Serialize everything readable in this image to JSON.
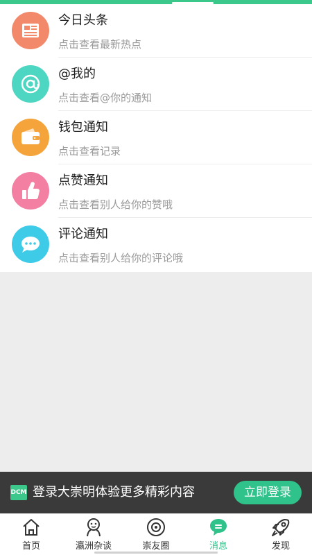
{
  "messages": [
    {
      "title": "今日头条",
      "subtitle": "点击查看最新热点",
      "icon": "newspaper-icon",
      "color": "#f2896b"
    },
    {
      "title": "@我的",
      "subtitle": "点击查看@你的通知",
      "icon": "at-icon",
      "color": "#4dd6c1"
    },
    {
      "title": "钱包通知",
      "subtitle": "点击查看记录",
      "icon": "wallet-icon",
      "color": "#f4a43a"
    },
    {
      "title": "点赞通知",
      "subtitle": "点击查看别人给你的赞哦",
      "icon": "thumbs-up-icon",
      "color": "#f37fa3"
    },
    {
      "title": "评论通知",
      "subtitle": "点击查看别人给你的评论哦",
      "icon": "comment-icon",
      "color": "#3dcbe8"
    }
  ],
  "login_banner": {
    "logo_text": "DCM",
    "text": "登录大崇明体验更多精彩内容",
    "button": "立即登录"
  },
  "tabbar": {
    "tabs": [
      {
        "label": "首页",
        "icon": "home-icon"
      },
      {
        "label": "瀛洲杂谈",
        "icon": "chat-persons-icon"
      },
      {
        "label": "崇友圈",
        "icon": "planet-icon"
      },
      {
        "label": "消息",
        "icon": "message-icon",
        "active": true
      },
      {
        "label": "发现",
        "icon": "rocket-icon"
      }
    ]
  },
  "colors": {
    "accent": "#2fc28a",
    "banner_bg": "#3a3a3a"
  }
}
